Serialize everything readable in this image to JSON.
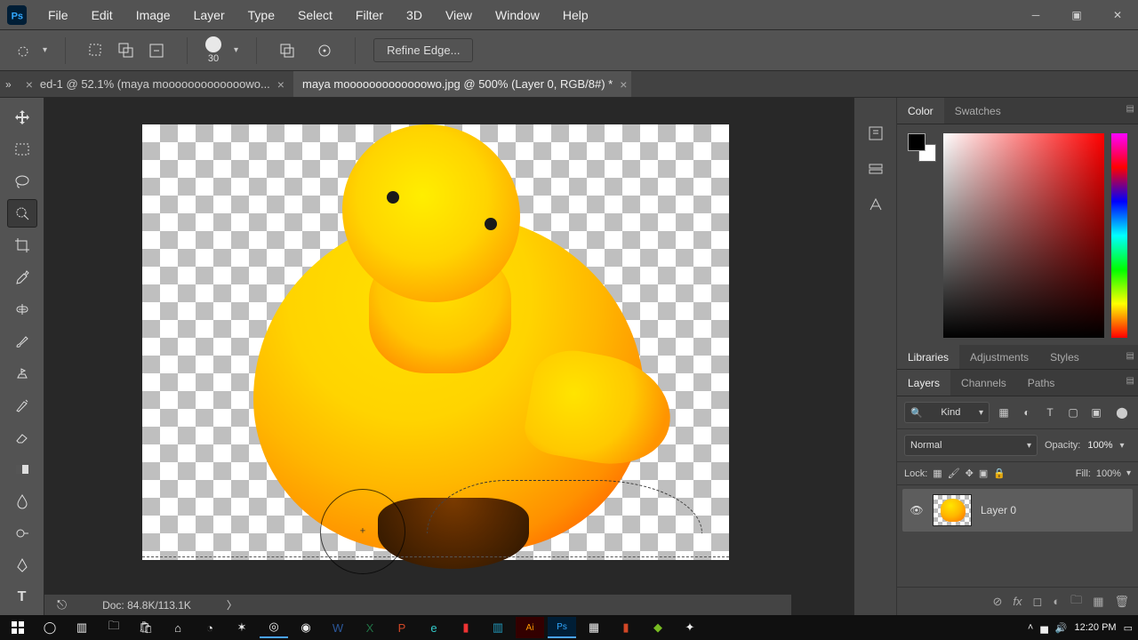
{
  "menu": {
    "items": [
      "File",
      "Edit",
      "Image",
      "Layer",
      "Type",
      "Select",
      "Filter",
      "3D",
      "View",
      "Window",
      "Help"
    ]
  },
  "options": {
    "brush_size": "30",
    "refine": "Refine Edge..."
  },
  "tabs": [
    {
      "label": "ed-1 @ 52.1% (maya mooooooooooooowo...",
      "active": false
    },
    {
      "label": "maya mooooooooooooowo.jpg @ 500% (Layer 0, RGB/8#) *",
      "active": true
    }
  ],
  "panels": {
    "color_tabs": [
      "Color",
      "Swatches"
    ],
    "mid_tabs": [
      "Libraries",
      "Adjustments",
      "Styles"
    ],
    "layer_tabs": [
      "Layers",
      "Channels",
      "Paths"
    ]
  },
  "layers": {
    "kind_label": "Kind",
    "blend_mode": "Normal",
    "opacity_label": "Opacity:",
    "opacity_value": "100%",
    "lock_label": "Lock:",
    "fill_label": "Fill:",
    "fill_value": "100%",
    "items": [
      {
        "name": "Layer 0"
      }
    ]
  },
  "status": {
    "doc": "Doc: 84.8K/113.1K"
  },
  "tray": {
    "time": "12:20 PM",
    "date": ""
  },
  "icons": {
    "search": "🔍",
    "move": "✥",
    "marquee": "▭",
    "lasso": "◯",
    "quicksel": "✦",
    "crop": "▦",
    "eyedrop": "✎",
    "heal": "✚",
    "brush": "🖌",
    "stamp": "⎌",
    "history": "↺",
    "eraser": "▱",
    "gradient": "▤",
    "blur": "◉",
    "pen": "✒",
    "text": "T"
  }
}
